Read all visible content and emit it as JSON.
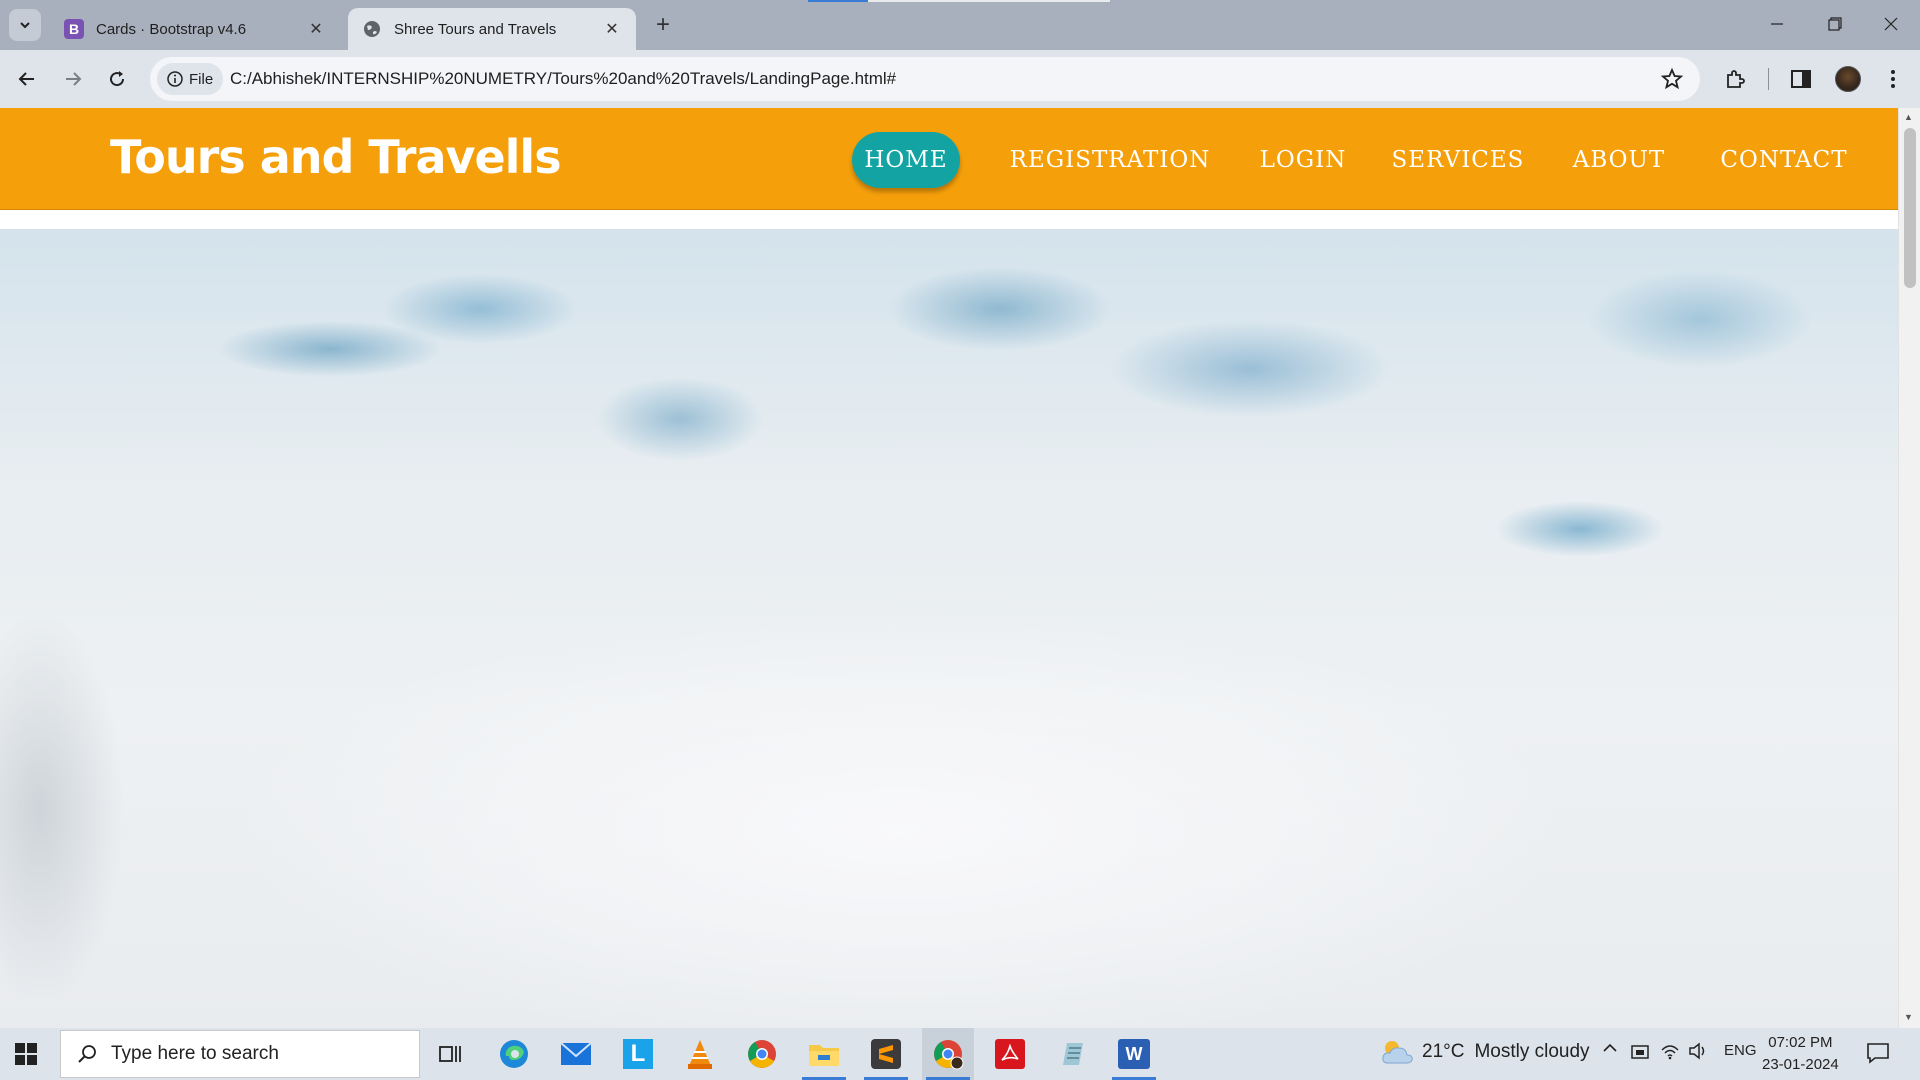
{
  "browser": {
    "tabs": [
      {
        "title": "Cards · Bootstrap v4.6",
        "favicon": "bootstrap-icon",
        "active": false
      },
      {
        "title": "Shree Tours and Travels",
        "favicon": "globe-icon",
        "active": true
      }
    ],
    "address": {
      "chip_label": "File",
      "url": "C:/Abhishek/INTERNSHIP%20NUMETRY/Tours%20and%20Travels/LandingPage.html#"
    }
  },
  "site": {
    "brand": "Tours and Travells",
    "nav": [
      {
        "label": "HOME",
        "active": true
      },
      {
        "label": "REGISTRATION",
        "active": false
      },
      {
        "label": "LOGIN",
        "active": false
      },
      {
        "label": "SERVICES",
        "active": false
      },
      {
        "label": "ABOUT",
        "active": false
      },
      {
        "label": "CONTACT",
        "active": false
      }
    ],
    "colors": {
      "navbar": "#f59f0b",
      "active_pill": "#14a3a3",
      "text": "#ffffff"
    }
  },
  "taskbar": {
    "search_placeholder": "Type here to search",
    "apps": [
      "task-view-icon",
      "edge-icon",
      "mail-icon",
      "l-app-icon",
      "vlc-icon",
      "chrome-icon",
      "file-explorer-icon",
      "sublime-icon",
      "chrome-profile-icon",
      "acrobat-icon",
      "notepad-icon",
      "word-icon"
    ],
    "weather": {
      "temp": "21°C",
      "condition": "Mostly cloudy"
    },
    "language": "ENG",
    "time": "07:02 PM",
    "date": "23-01-2024"
  }
}
